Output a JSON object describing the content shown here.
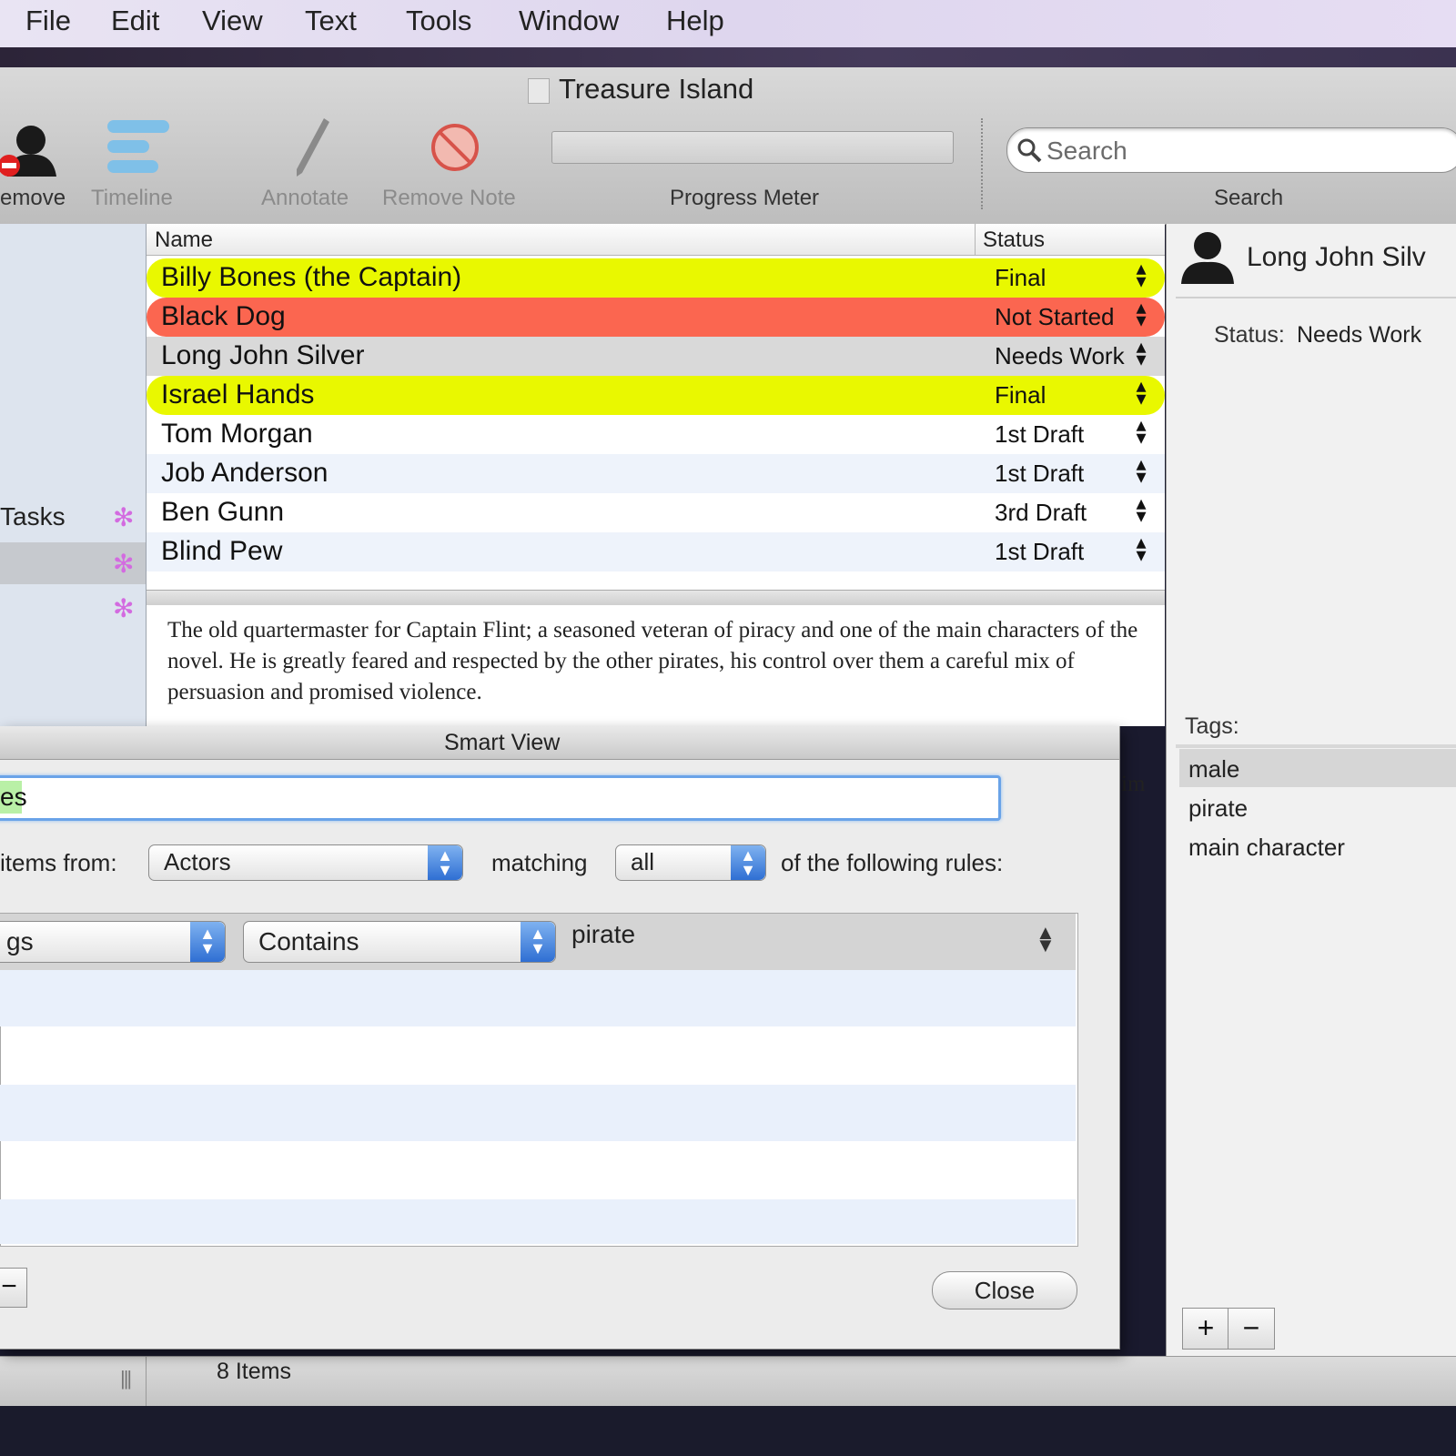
{
  "menu": [
    "File",
    "Edit",
    "View",
    "Text",
    "Tools",
    "Window",
    "Help"
  ],
  "window": {
    "title": "Treasure Island"
  },
  "toolbar": {
    "remove": "emove",
    "timeline": "Timeline",
    "annotate": "Annotate",
    "remove_note": "Remove Note",
    "progress": "Progress Meter",
    "search_label": "Search",
    "search_placeholder": "Search"
  },
  "sidebar": {
    "tasks_label": "Tasks"
  },
  "table": {
    "columns": [
      "Name",
      "Status"
    ],
    "rows": [
      {
        "name": "Billy Bones (the Captain)",
        "status": "Final",
        "color": "#e9f800"
      },
      {
        "name": "Black Dog",
        "status": "Not Started",
        "color": "#fb6650"
      },
      {
        "name": "Long John Silver",
        "status": "Needs Work",
        "color": "#d9d9d9"
      },
      {
        "name": "Israel Hands",
        "status": "Final",
        "color": "#e9f800"
      },
      {
        "name": "Tom Morgan",
        "status": "1st Draft",
        "color": "#ffffff"
      },
      {
        "name": "Job Anderson",
        "status": "1st Draft",
        "color": "#eef3fb"
      },
      {
        "name": "Ben Gunn",
        "status": "3rd Draft",
        "color": "#ffffff"
      },
      {
        "name": "Blind Pew",
        "status": "1st Draft",
        "color": "#eef3fb"
      }
    ]
  },
  "notes": {
    "text": "The old quartermaster for Captain Flint; a seasoned veteran of piracy and one of the main characters of the novel.  He is greatly feared and respected by the other pirates, his control over them a careful mix of persuasion and promised violence.",
    "peek": "im"
  },
  "inspector": {
    "name": "Long John Silv",
    "status_label": "Status:",
    "status_value": "Needs Work",
    "tags_label": "Tags:",
    "tags": [
      "male",
      "pirate",
      "main character"
    ],
    "add": "+",
    "remove": "−"
  },
  "status_bar": {
    "items": "8 Items"
  },
  "smart_view": {
    "title": "Smart View",
    "name_value": "es",
    "items_from_label": "items from:",
    "source": "Actors",
    "matching_label": "matching",
    "match_mode": "all",
    "following_label": "of the following rules:",
    "rule_field": "gs",
    "rule_op": "Contains",
    "rule_value": "pirate",
    "close": "Close",
    "remove_rule": "−"
  }
}
